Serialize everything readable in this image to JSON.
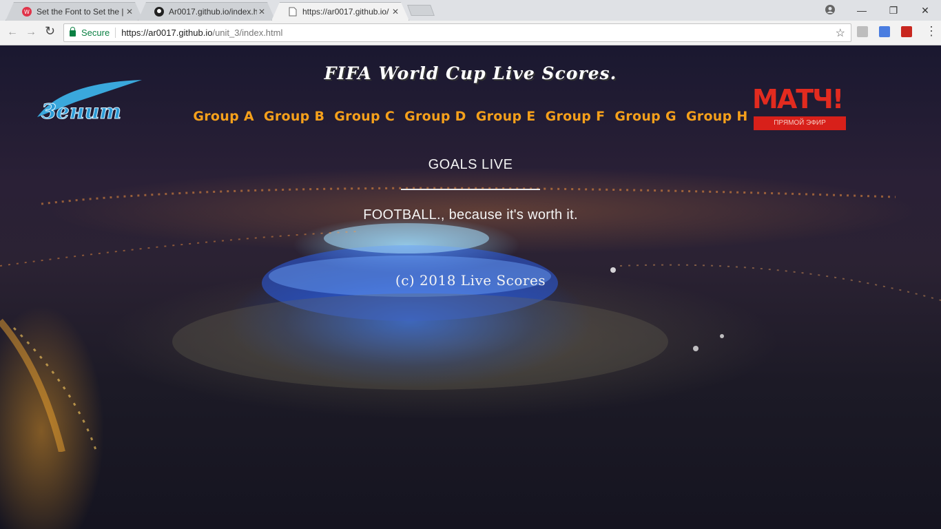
{
  "browser": {
    "tabs": [
      {
        "title": "Set the Font to Set the |",
        "close": "✕"
      },
      {
        "title": "Ar0017.github.io/index.h",
        "close": "✕"
      },
      {
        "title": "https://ar0017.github.io/",
        "close": "✕"
      }
    ],
    "window_controls": {
      "minimize": "—",
      "maximize": "❐",
      "close": "✕"
    },
    "nav": {
      "back": "←",
      "forward": "→",
      "reload": "↻"
    },
    "security_label": "Secure",
    "url_host": "https://ar0017.github.io",
    "url_path": "/unit_3/index.html",
    "bookmark_star": "☆",
    "menu": "⋮"
  },
  "page": {
    "title": "FIFA World Cup Live Scores.",
    "groups": [
      "Group A",
      "Group B",
      "Group C",
      "Group D",
      "Group E",
      "Group F",
      "Group G",
      "Group H"
    ],
    "goals_heading": "GOALS LIVE",
    "tagline": "FOOTBALL., because it's worth it.",
    "copyright": "(c) 2018 Live Scores",
    "left_logo_text": "Зенит",
    "right_logo_text": "МАТЧ!",
    "right_logo_subtext": "ПРЯМОЙ ЭФИР"
  },
  "colors": {
    "group_link": "#f5a01b",
    "secure": "#0b8043",
    "stadium_glow": "#2f6bff"
  }
}
